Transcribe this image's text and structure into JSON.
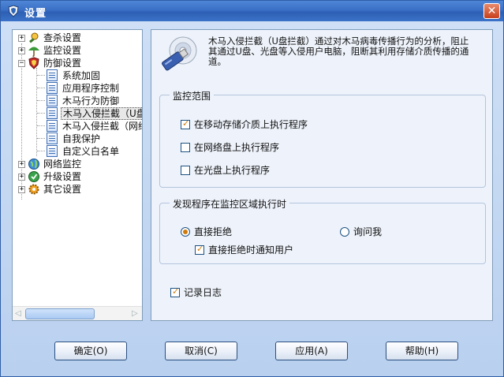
{
  "window": {
    "title": "设置",
    "close_glyph": "✕"
  },
  "tree": {
    "nodes": [
      {
        "label": "查杀设置",
        "expander": "+",
        "icon": "search-virus-icon"
      },
      {
        "label": "监控设置",
        "expander": "+",
        "icon": "monitor-umbrella-icon"
      },
      {
        "label": "防御设置",
        "expander": "−",
        "icon": "shield-icon"
      },
      {
        "label": "网络监控",
        "expander": "+",
        "icon": "network-globe-icon"
      },
      {
        "label": "升级设置",
        "expander": "+",
        "icon": "upgrade-icon"
      },
      {
        "label": "其它设置",
        "expander": "+",
        "icon": "gear-icon"
      }
    ],
    "defense_children": [
      "系统加固",
      "应用程序控制",
      "木马行为防御",
      "木马入侵拦截（U盘",
      "木马入侵拦截（网络",
      "自我保护",
      "自定义白名单"
    ],
    "selected_index": 3,
    "scroll_left_glyph": "◁",
    "scroll_right_glyph": "▷"
  },
  "content": {
    "description": "木马入侵拦截（U盘拦截）通过对木马病毒传播行为的分析，阻止其通过U盘、光盘等入侵用户电脑，阻断其利用存储介质传播的通道。",
    "scope_group": {
      "title": "监控范围",
      "options": [
        {
          "label": "在移动存储介质上执行程序",
          "checked": true
        },
        {
          "label": "在网络盘上执行程序",
          "checked": false
        },
        {
          "label": "在光盘上执行程序",
          "checked": false
        }
      ]
    },
    "action_group": {
      "title": "发现程序在监控区域执行时",
      "radio_block": {
        "label": "直接拒绝",
        "selected": true
      },
      "radio_ask": {
        "label": "询问我",
        "selected": false
      },
      "notify": {
        "label": "直接拒绝时通知用户",
        "checked": true
      }
    },
    "log": {
      "label": "记录日志",
      "checked": true
    }
  },
  "buttons": {
    "ok": "确定(O)",
    "cancel": "取消(C)",
    "apply": "应用(A)",
    "help": "帮助(H)"
  },
  "colors": {
    "accent": "#d07a0a",
    "titlebar": "#3a70c6"
  }
}
